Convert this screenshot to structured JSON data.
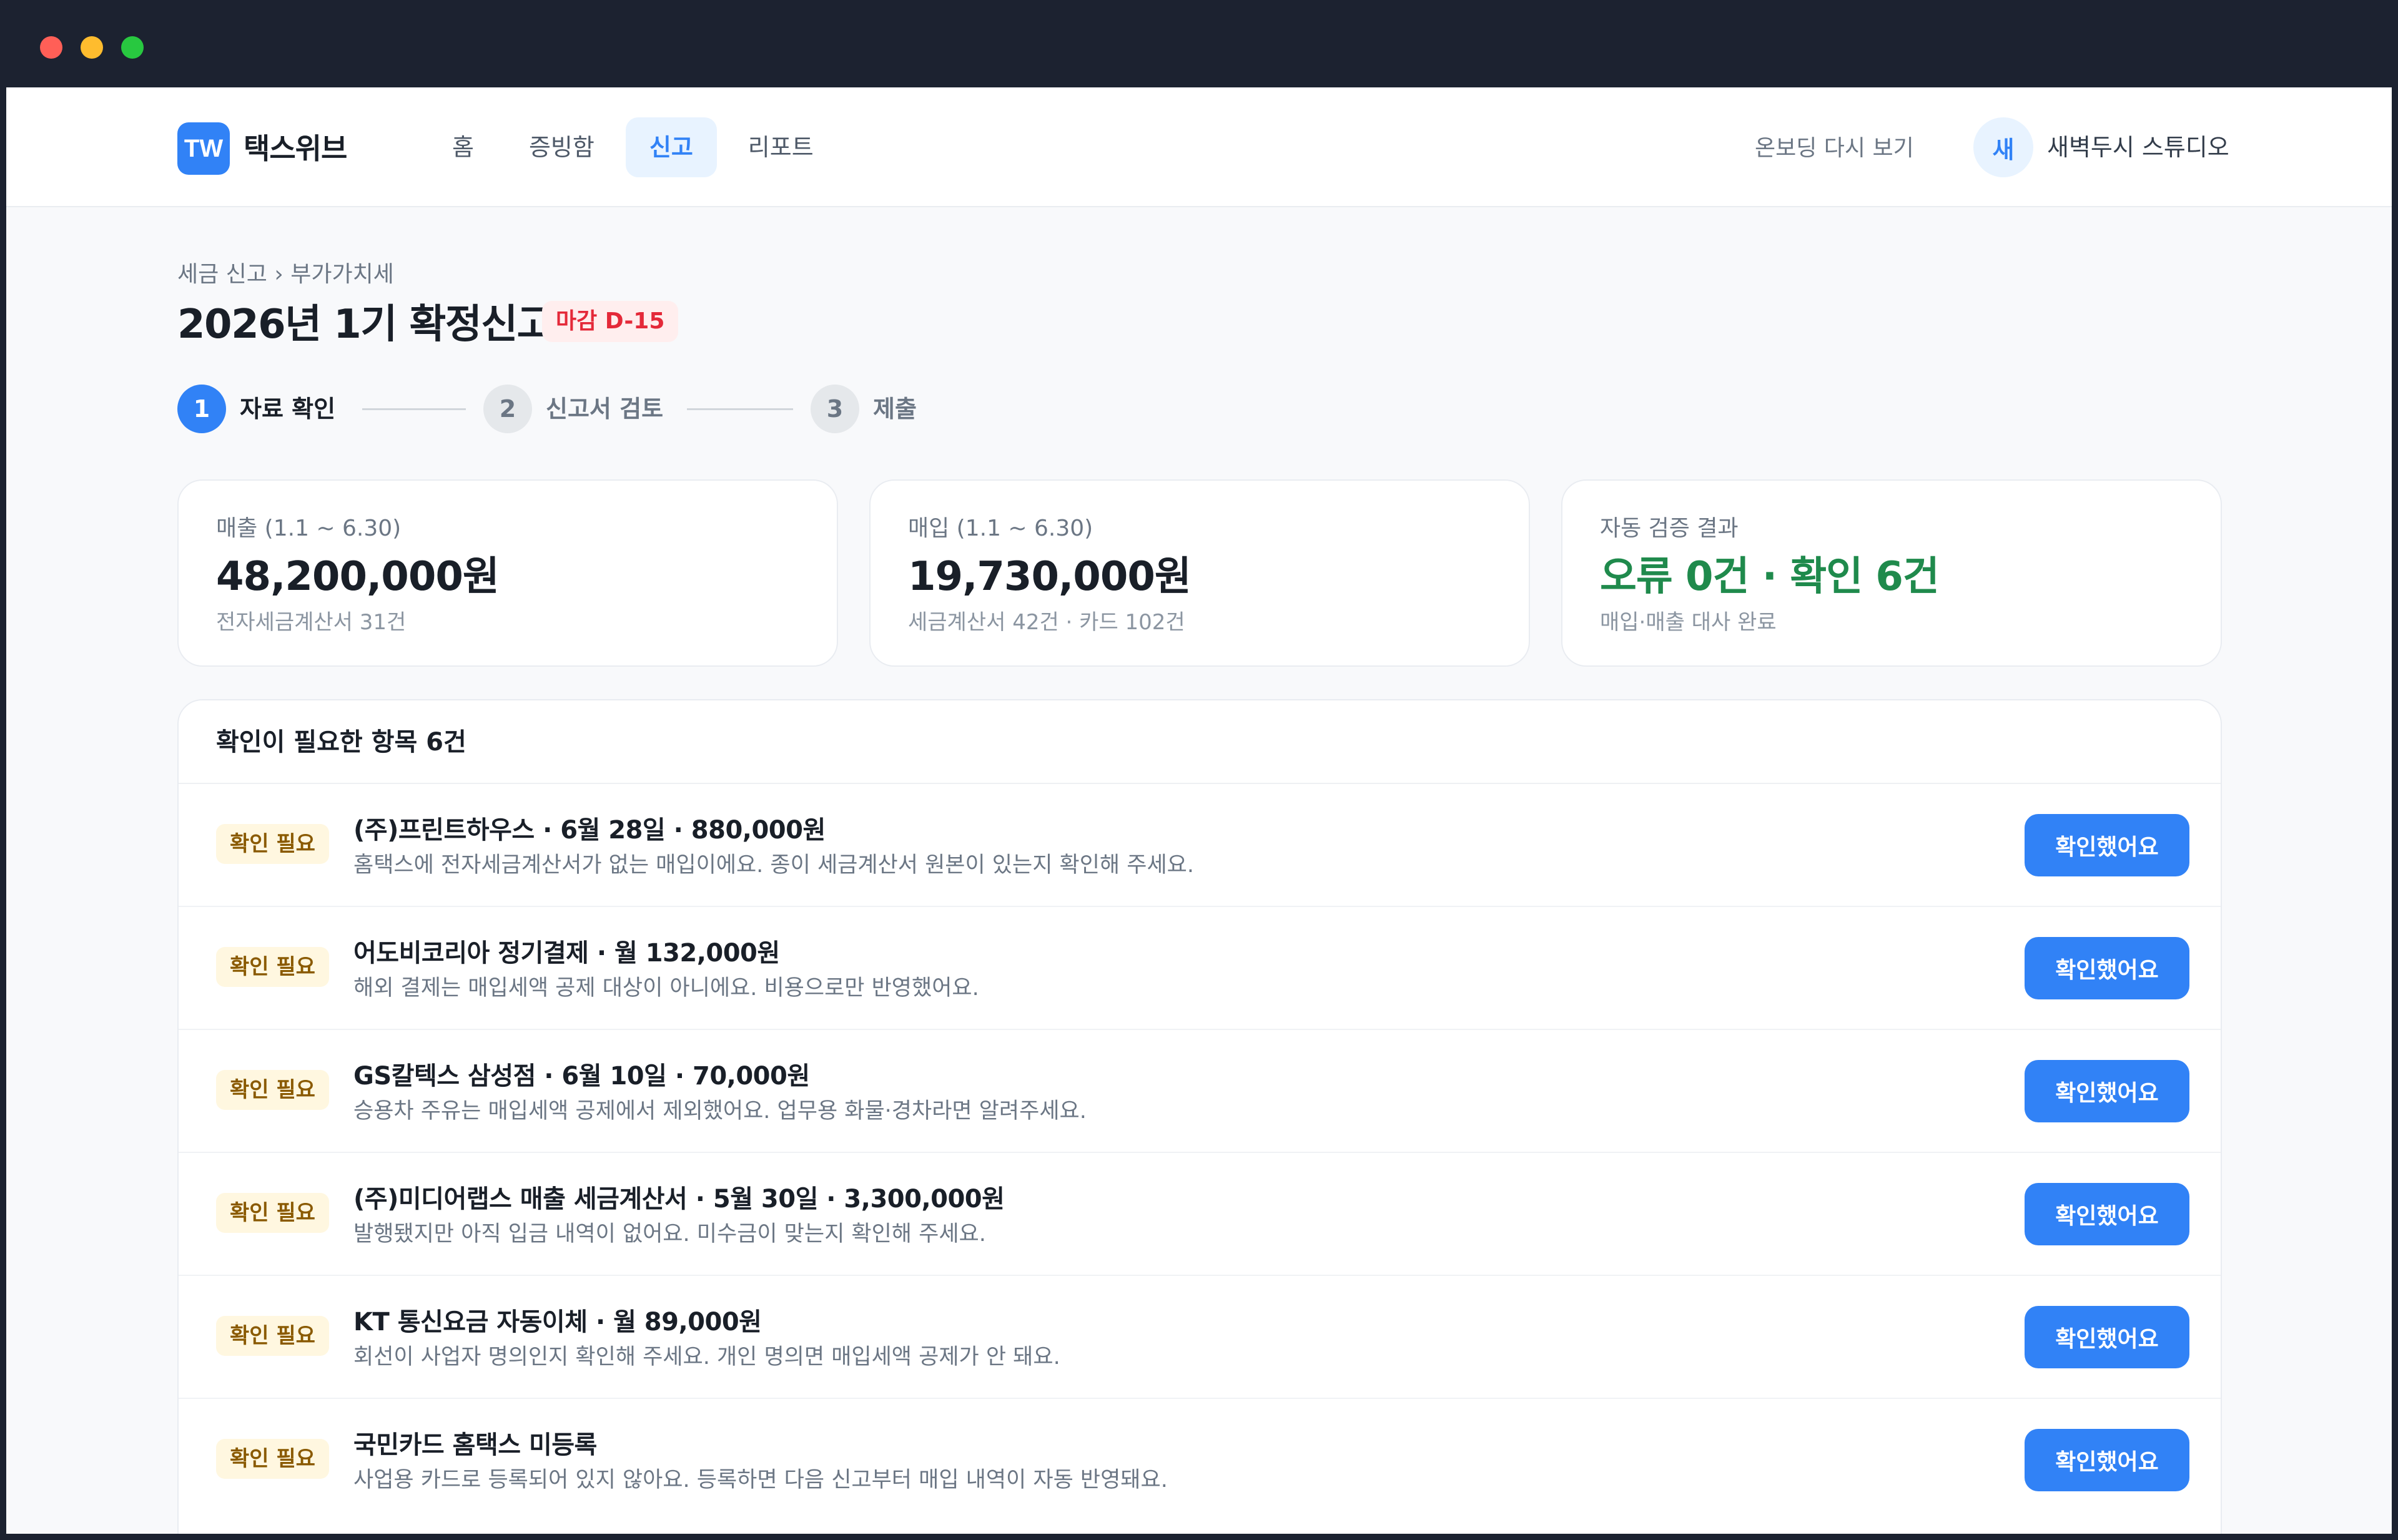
{
  "window": {
    "controls": [
      "close",
      "minimize",
      "maximize"
    ]
  },
  "header": {
    "logo_mark": "TW",
    "logo_name": "택스위브",
    "nav": [
      {
        "label": "홈",
        "active": false
      },
      {
        "label": "증빙함",
        "active": false
      },
      {
        "label": "신고",
        "active": true
      },
      {
        "label": "리포트",
        "active": false
      }
    ],
    "onboarding_link": "온보딩 다시 보기",
    "avatar_initial": "새",
    "user_name": "새벽두시 스튜디오"
  },
  "page": {
    "breadcrumb": "세금 신고 › 부가가치세",
    "title": "2026년 1기 확정신고",
    "deadline_badge": "마감 D-15"
  },
  "stepper": [
    {
      "number": "1",
      "label": "자료 확인",
      "active": true
    },
    {
      "number": "2",
      "label": "신고서 검토",
      "active": false
    },
    {
      "number": "3",
      "label": "제출",
      "active": false
    }
  ],
  "summary": [
    {
      "label": "매출 (1.1 ~ 6.30)",
      "value": "48,200,000원",
      "sub": "전자세금계산서 31건"
    },
    {
      "label": "매입 (1.1 ~ 6.30)",
      "value": "19,730,000원",
      "sub": "세금계산서 42건 · 카드 102건"
    },
    {
      "label": "자동 검증 결과",
      "value": "오류 0건 · 확인 6건",
      "sub": "매입·매출 대사 완료"
    }
  ],
  "review": {
    "title": "확인이 필요한 항목 6건",
    "items": [
      {
        "badge": "확인 필요",
        "title": "(주)프린트하우스 · 6월 28일 · 880,000원",
        "desc": "홈택스에 전자세금계산서가 없는 매입이에요. 종이 세금계산서 원본이 있는지 확인해 주세요.",
        "button": "확인했어요"
      },
      {
        "badge": "확인 필요",
        "title": "어도비코리아 정기결제 · 월 132,000원",
        "desc": "해외 결제는 매입세액 공제 대상이 아니에요. 비용으로만 반영했어요.",
        "button": "확인했어요"
      },
      {
        "badge": "확인 필요",
        "title": "GS칼텍스 삼성점 · 6월 10일 · 70,000원",
        "desc": "승용차 주유는 매입세액 공제에서 제외했어요. 업무용 화물·경차라면 알려주세요.",
        "button": "확인했어요"
      },
      {
        "badge": "확인 필요",
        "title": "(주)미디어랩스 매출 세금계산서 · 5월 30일 · 3,300,000원",
        "desc": "발행됐지만 아직 입금 내역이 없어요. 미수금이 맞는지 확인해 주세요.",
        "button": "확인했어요"
      },
      {
        "badge": "확인 필요",
        "title": "KT 통신요금 자동이체 · 월 89,000원",
        "desc": "회선이 사업자 명의인지 확인해 주세요. 개인 명의면 매입세액 공제가 안 돼요.",
        "button": "확인했어요"
      },
      {
        "badge": "확인 필요",
        "title": "국민카드 홈택스 미등록",
        "desc": "사업용 카드로 등록되어 있지 않아요. 등록하면 다음 신고부터 매입 내역이 자동 반영돼요.",
        "button": "확인했어요"
      }
    ]
  },
  "colors": {
    "accent": "#3182f6",
    "success": "#1f8a4c",
    "danger": "#e42939",
    "warning_badge_bg": "#fff7e0"
  }
}
